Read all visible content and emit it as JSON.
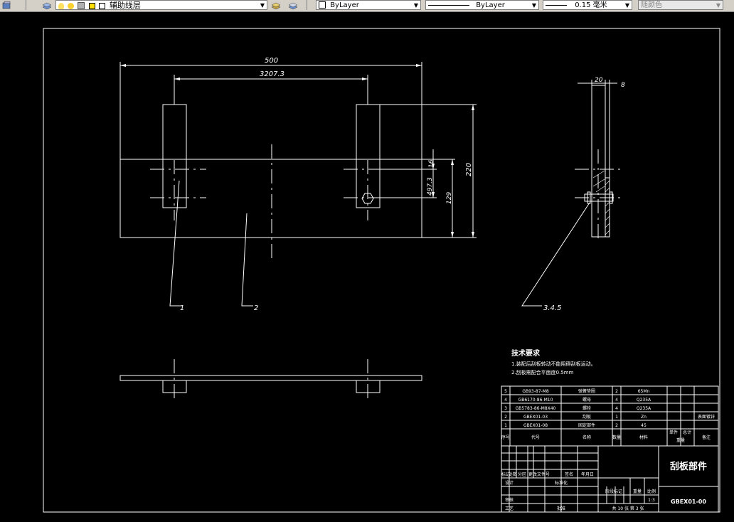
{
  "toolbar": {
    "layer_name": "辅助线层",
    "color_value": "ByLayer",
    "linetype_value": "ByLayer",
    "lineweight_value": "0.15 毫米",
    "plotstyle_value": "随颜色"
  },
  "drawing": {
    "dim_overall_width": "500",
    "dim_hole_spacing": "3207.3",
    "dim_height": "220",
    "dim_offset_16": "16",
    "dim_slot_497": "497.3",
    "dim_129": "129",
    "dim_side_20": "20",
    "dim_side_8": "8",
    "label_1": "1",
    "label_2": "2",
    "label_345": "3.4.5",
    "tech_title": "技术要求",
    "tech_note_1": "1.装配后刮板转动不能阻碍刮板运动。",
    "tech_note_2": "2.刮板需配合平面度0.5mm"
  },
  "bom": {
    "rows": [
      {
        "no": "5",
        "code": "GB93-87-M8",
        "name": "弹簧垫圈",
        "qty": "2",
        "material": "65Mn",
        "remark": ""
      },
      {
        "no": "4",
        "code": "GB6170-86-M10",
        "name": "螺母",
        "qty": "4",
        "material": "Q235A",
        "remark": ""
      },
      {
        "no": "3",
        "code": "GB5783-86-M8X40",
        "name": "螺栓",
        "qty": "4",
        "material": "Q235A",
        "remark": ""
      },
      {
        "no": "2",
        "code": "GBEX01-03",
        "name": "刮板",
        "qty": "1",
        "material": "Zn",
        "remark": "表面镀锌"
      },
      {
        "no": "1",
        "code": "GBEX01-08",
        "name": "固定部件",
        "qty": "2",
        "material": "45",
        "remark": ""
      }
    ],
    "header": {
      "no": "序号",
      "code": "代号",
      "name": "名称",
      "qty": "数量",
      "material": "材料",
      "unit_weight": "单件",
      "total_weight": "总计",
      "weight": "重量",
      "remark": "备注"
    }
  },
  "title_block": {
    "part_name": "刮板部件",
    "drawing_code": "GBEX01-00",
    "scale": "1:3",
    "sheet_info": "共 10 张  第 3 张",
    "labels": {
      "marking": "标记",
      "count": "处数",
      "zone": "分区",
      "change_doc": "更改文件号",
      "sign": "签名",
      "date": "年月日",
      "design": "设计",
      "standardize": "标准化",
      "stage_mark": "阶段标记",
      "weight": "重量",
      "scale_label": "比例",
      "review": "审核",
      "process": "工艺",
      "approve": "批准"
    }
  }
}
